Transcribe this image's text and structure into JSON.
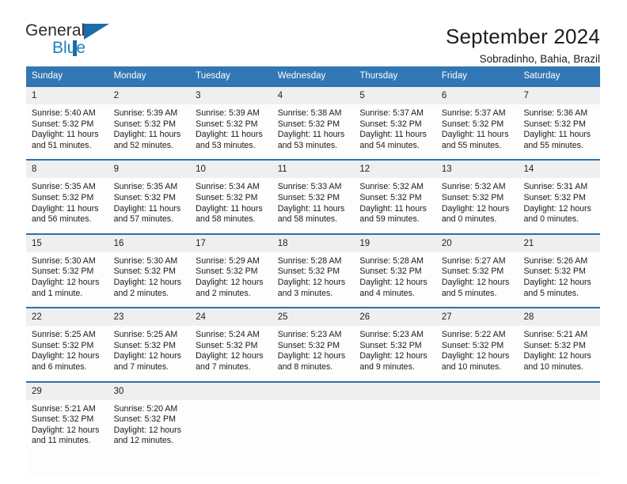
{
  "brand": {
    "name_top": "General",
    "name_bottom": "Blue",
    "accent_color": "#1b6ca8"
  },
  "header": {
    "title": "September 2024",
    "location": "Sobradinho, Bahia, Brazil"
  },
  "theme": {
    "header_blue": "#3177b5",
    "row_border_blue": "#2f6fad",
    "day_band_gray": "#efefef"
  },
  "weekdays": [
    "Sunday",
    "Monday",
    "Tuesday",
    "Wednesday",
    "Thursday",
    "Friday",
    "Saturday"
  ],
  "weeks": [
    [
      {
        "day": "1",
        "sunrise": "Sunrise: 5:40 AM",
        "sunset": "Sunset: 5:32 PM",
        "daylight1": "Daylight: 11 hours",
        "daylight2": "and 51 minutes."
      },
      {
        "day": "2",
        "sunrise": "Sunrise: 5:39 AM",
        "sunset": "Sunset: 5:32 PM",
        "daylight1": "Daylight: 11 hours",
        "daylight2": "and 52 minutes."
      },
      {
        "day": "3",
        "sunrise": "Sunrise: 5:39 AM",
        "sunset": "Sunset: 5:32 PM",
        "daylight1": "Daylight: 11 hours",
        "daylight2": "and 53 minutes."
      },
      {
        "day": "4",
        "sunrise": "Sunrise: 5:38 AM",
        "sunset": "Sunset: 5:32 PM",
        "daylight1": "Daylight: 11 hours",
        "daylight2": "and 53 minutes."
      },
      {
        "day": "5",
        "sunrise": "Sunrise: 5:37 AM",
        "sunset": "Sunset: 5:32 PM",
        "daylight1": "Daylight: 11 hours",
        "daylight2": "and 54 minutes."
      },
      {
        "day": "6",
        "sunrise": "Sunrise: 5:37 AM",
        "sunset": "Sunset: 5:32 PM",
        "daylight1": "Daylight: 11 hours",
        "daylight2": "and 55 minutes."
      },
      {
        "day": "7",
        "sunrise": "Sunrise: 5:36 AM",
        "sunset": "Sunset: 5:32 PM",
        "daylight1": "Daylight: 11 hours",
        "daylight2": "and 55 minutes."
      }
    ],
    [
      {
        "day": "8",
        "sunrise": "Sunrise: 5:35 AM",
        "sunset": "Sunset: 5:32 PM",
        "daylight1": "Daylight: 11 hours",
        "daylight2": "and 56 minutes."
      },
      {
        "day": "9",
        "sunrise": "Sunrise: 5:35 AM",
        "sunset": "Sunset: 5:32 PM",
        "daylight1": "Daylight: 11 hours",
        "daylight2": "and 57 minutes."
      },
      {
        "day": "10",
        "sunrise": "Sunrise: 5:34 AM",
        "sunset": "Sunset: 5:32 PM",
        "daylight1": "Daylight: 11 hours",
        "daylight2": "and 58 minutes."
      },
      {
        "day": "11",
        "sunrise": "Sunrise: 5:33 AM",
        "sunset": "Sunset: 5:32 PM",
        "daylight1": "Daylight: 11 hours",
        "daylight2": "and 58 minutes."
      },
      {
        "day": "12",
        "sunrise": "Sunrise: 5:32 AM",
        "sunset": "Sunset: 5:32 PM",
        "daylight1": "Daylight: 11 hours",
        "daylight2": "and 59 minutes."
      },
      {
        "day": "13",
        "sunrise": "Sunrise: 5:32 AM",
        "sunset": "Sunset: 5:32 PM",
        "daylight1": "Daylight: 12 hours",
        "daylight2": "and 0 minutes."
      },
      {
        "day": "14",
        "sunrise": "Sunrise: 5:31 AM",
        "sunset": "Sunset: 5:32 PM",
        "daylight1": "Daylight: 12 hours",
        "daylight2": "and 0 minutes."
      }
    ],
    [
      {
        "day": "15",
        "sunrise": "Sunrise: 5:30 AM",
        "sunset": "Sunset: 5:32 PM",
        "daylight1": "Daylight: 12 hours",
        "daylight2": "and 1 minute."
      },
      {
        "day": "16",
        "sunrise": "Sunrise: 5:30 AM",
        "sunset": "Sunset: 5:32 PM",
        "daylight1": "Daylight: 12 hours",
        "daylight2": "and 2 minutes."
      },
      {
        "day": "17",
        "sunrise": "Sunrise: 5:29 AM",
        "sunset": "Sunset: 5:32 PM",
        "daylight1": "Daylight: 12 hours",
        "daylight2": "and 2 minutes."
      },
      {
        "day": "18",
        "sunrise": "Sunrise: 5:28 AM",
        "sunset": "Sunset: 5:32 PM",
        "daylight1": "Daylight: 12 hours",
        "daylight2": "and 3 minutes."
      },
      {
        "day": "19",
        "sunrise": "Sunrise: 5:28 AM",
        "sunset": "Sunset: 5:32 PM",
        "daylight1": "Daylight: 12 hours",
        "daylight2": "and 4 minutes."
      },
      {
        "day": "20",
        "sunrise": "Sunrise: 5:27 AM",
        "sunset": "Sunset: 5:32 PM",
        "daylight1": "Daylight: 12 hours",
        "daylight2": "and 5 minutes."
      },
      {
        "day": "21",
        "sunrise": "Sunrise: 5:26 AM",
        "sunset": "Sunset: 5:32 PM",
        "daylight1": "Daylight: 12 hours",
        "daylight2": "and 5 minutes."
      }
    ],
    [
      {
        "day": "22",
        "sunrise": "Sunrise: 5:25 AM",
        "sunset": "Sunset: 5:32 PM",
        "daylight1": "Daylight: 12 hours",
        "daylight2": "and 6 minutes."
      },
      {
        "day": "23",
        "sunrise": "Sunrise: 5:25 AM",
        "sunset": "Sunset: 5:32 PM",
        "daylight1": "Daylight: 12 hours",
        "daylight2": "and 7 minutes."
      },
      {
        "day": "24",
        "sunrise": "Sunrise: 5:24 AM",
        "sunset": "Sunset: 5:32 PM",
        "daylight1": "Daylight: 12 hours",
        "daylight2": "and 7 minutes."
      },
      {
        "day": "25",
        "sunrise": "Sunrise: 5:23 AM",
        "sunset": "Sunset: 5:32 PM",
        "daylight1": "Daylight: 12 hours",
        "daylight2": "and 8 minutes."
      },
      {
        "day": "26",
        "sunrise": "Sunrise: 5:23 AM",
        "sunset": "Sunset: 5:32 PM",
        "daylight1": "Daylight: 12 hours",
        "daylight2": "and 9 minutes."
      },
      {
        "day": "27",
        "sunrise": "Sunrise: 5:22 AM",
        "sunset": "Sunset: 5:32 PM",
        "daylight1": "Daylight: 12 hours",
        "daylight2": "and 10 minutes."
      },
      {
        "day": "28",
        "sunrise": "Sunrise: 5:21 AM",
        "sunset": "Sunset: 5:32 PM",
        "daylight1": "Daylight: 12 hours",
        "daylight2": "and 10 minutes."
      }
    ],
    [
      {
        "day": "29",
        "sunrise": "Sunrise: 5:21 AM",
        "sunset": "Sunset: 5:32 PM",
        "daylight1": "Daylight: 12 hours",
        "daylight2": "and 11 minutes."
      },
      {
        "day": "30",
        "sunrise": "Sunrise: 5:20 AM",
        "sunset": "Sunset: 5:32 PM",
        "daylight1": "Daylight: 12 hours",
        "daylight2": "and 12 minutes."
      },
      {
        "day": "",
        "sunrise": "",
        "sunset": "",
        "daylight1": "",
        "daylight2": ""
      },
      {
        "day": "",
        "sunrise": "",
        "sunset": "",
        "daylight1": "",
        "daylight2": ""
      },
      {
        "day": "",
        "sunrise": "",
        "sunset": "",
        "daylight1": "",
        "daylight2": ""
      },
      {
        "day": "",
        "sunrise": "",
        "sunset": "",
        "daylight1": "",
        "daylight2": ""
      },
      {
        "day": "",
        "sunrise": "",
        "sunset": "",
        "daylight1": "",
        "daylight2": ""
      }
    ]
  ]
}
